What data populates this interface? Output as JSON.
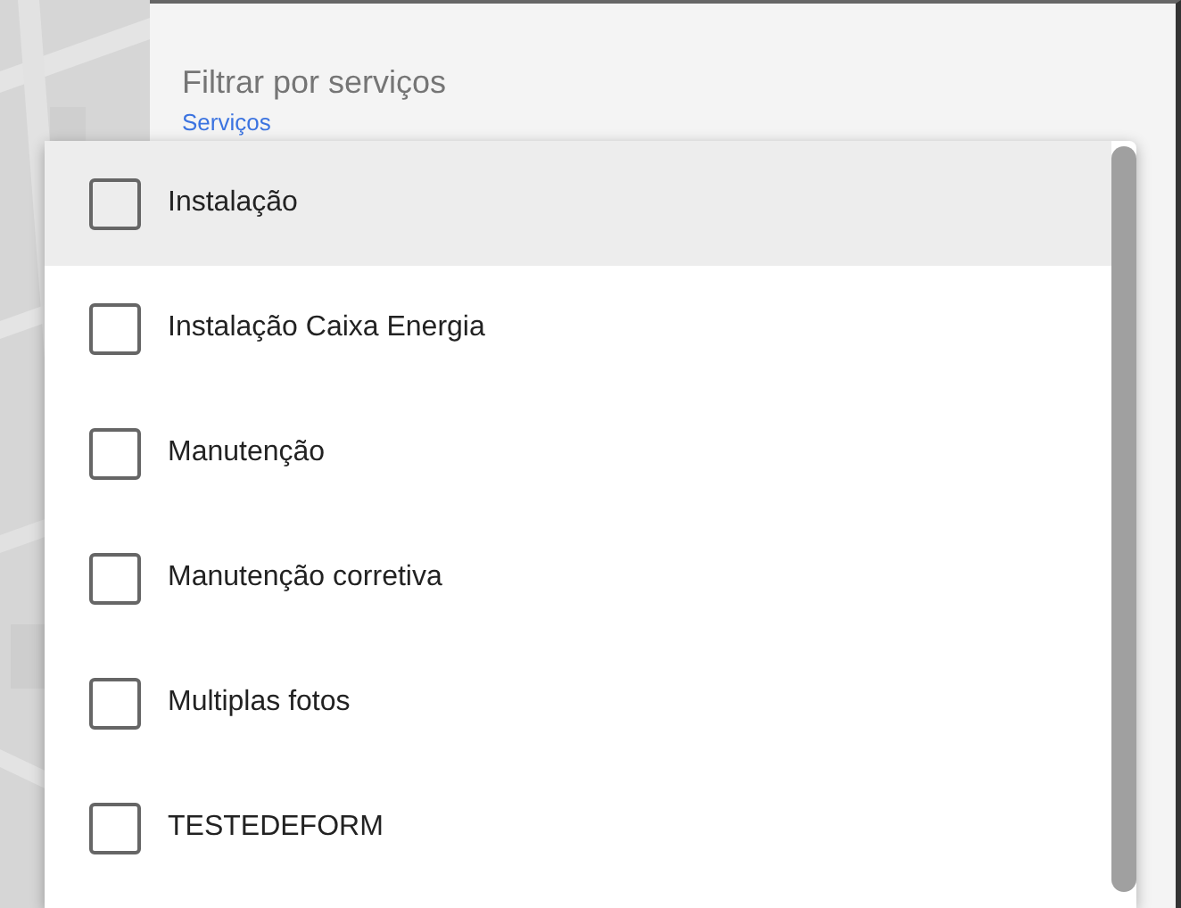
{
  "panel": {
    "title": "Filtrar por serviços",
    "field_label": "Serviços"
  },
  "dropdown": {
    "options": [
      {
        "label": "Instalação",
        "checked": false,
        "highlighted": true
      },
      {
        "label": "Instalação Caixa Energia",
        "checked": false,
        "highlighted": false
      },
      {
        "label": "Manutenção",
        "checked": false,
        "highlighted": false
      },
      {
        "label": "Manutenção corretiva",
        "checked": false,
        "highlighted": false
      },
      {
        "label": "Multiplas fotos",
        "checked": false,
        "highlighted": false
      },
      {
        "label": "TESTEDEFORM",
        "checked": false,
        "highlighted": false
      }
    ]
  }
}
